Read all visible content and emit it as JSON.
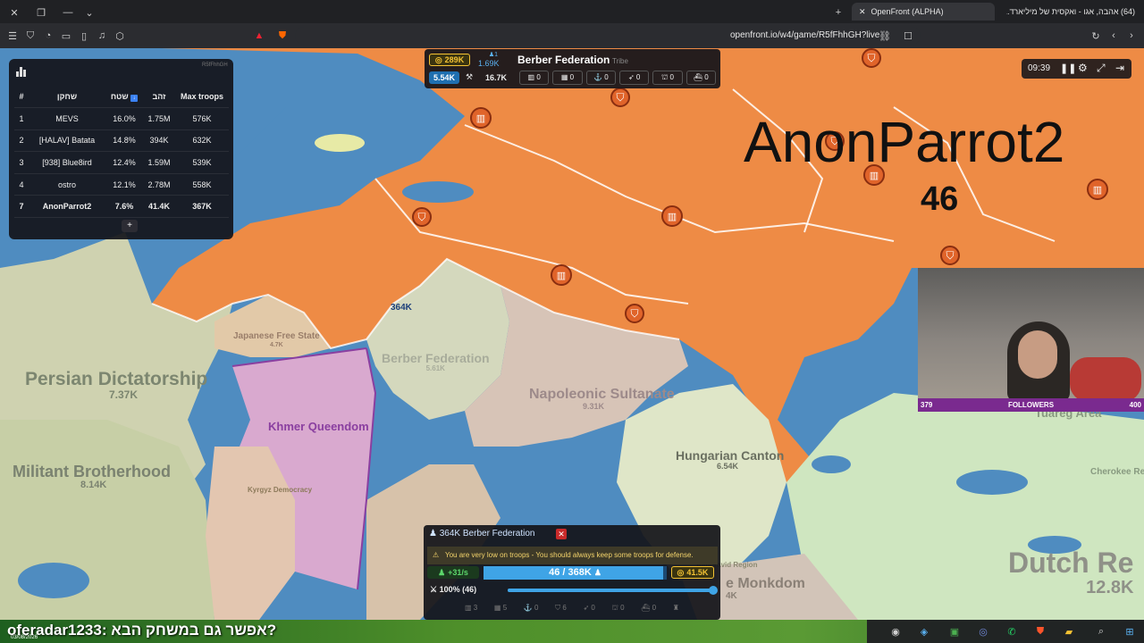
{
  "browser": {
    "tabs": [
      {
        "label": "OpenFront (ALPHA)"
      },
      {
        "label": "(64) אהבה, אגו - ואקסית של מיליארד..."
      }
    ],
    "url": "openfront.io/w4/game/R5fFhhGH?live"
  },
  "leaderboard": {
    "game_id": "R5fFhhGH",
    "headers": {
      "rank": "#",
      "player": "שחקן",
      "land": "שטח",
      "gold": "זהב",
      "troops": "Max troops"
    },
    "rows": [
      {
        "rank": "1",
        "player": "MEVS",
        "land": "16.0%",
        "gold": "1.75M",
        "troops": "576K"
      },
      {
        "rank": "2",
        "player": "[HALAV] Batata",
        "land": "14.8%",
        "gold": "394K",
        "troops": "632K"
      },
      {
        "rank": "3",
        "player": "[938] Blue8ird",
        "land": "12.4%",
        "gold": "1.59M",
        "troops": "539K"
      },
      {
        "rank": "4",
        "player": "ostro",
        "land": "12.1%",
        "gold": "2.78M",
        "troops": "558K"
      },
      {
        "rank": "7",
        "player": "AnonParrot2",
        "land": "7.6%",
        "gold": "41.4K",
        "troops": "367K"
      }
    ],
    "expand_label": "+"
  },
  "player_panel": {
    "gold": "289K",
    "troops_small": "1.69K",
    "name": "Berber Federation",
    "type": "Tribe",
    "troops": "5.54K",
    "workers": "16.7K",
    "stats": [
      "0",
      "0",
      "0",
      "0",
      "0",
      "0"
    ]
  },
  "time_panel": {
    "time": "09:39"
  },
  "map_labels": {
    "big_name": "AnonParrot2",
    "big_count": "46",
    "troop_marker": "364K",
    "regions": [
      {
        "name": "Persian Dictatorship",
        "value": "7.37K"
      },
      {
        "name": "Berber Federation",
        "value": "5.61K"
      },
      {
        "name": "Napoleonic Sultanate",
        "value": "9.31K"
      },
      {
        "name": "Khmer Queendom",
        "value": ""
      },
      {
        "name": "Militant Brotherhood",
        "value": "8.14K"
      },
      {
        "name": "Hungarian Canton",
        "value": "6.54K"
      },
      {
        "name": "Japanese Free State",
        "value": "4.7K"
      },
      {
        "name": "Kyrgyz Democracy",
        "value": ""
      },
      {
        "name": "Almoravid Region",
        "value": ""
      },
      {
        "name": "Tuareg Area",
        "value": ""
      },
      {
        "name": "Cherokee Rege",
        "value": ""
      },
      {
        "name": "Dutch Re",
        "value": "12.8K"
      },
      {
        "name": "e Monkdom",
        "value": "4K"
      }
    ]
  },
  "webcam": {
    "followers_label": "FOLLOWERS",
    "left_count": "379",
    "right_count": "400"
  },
  "control": {
    "target_troops": "364K",
    "target_name": "Berber Federation",
    "warning": "You are very low on troops - You should always keep some troops for defense.",
    "rate": "+31/s",
    "troops_text": "46 / 368K",
    "troops_ratio": 0.0001,
    "gold": "41.5K",
    "attack_ratio": "100% (46)",
    "slider_level": 1.0,
    "build_counts": [
      "3",
      "5",
      "0",
      "6",
      "0",
      "0",
      "0"
    ]
  },
  "stream": {
    "chat": "oferadar1233: אפשר גם במשחק הבא?",
    "date": "03/08/2026"
  },
  "colors": {
    "orange": "#ee8b45",
    "sea": "#4f8cc0",
    "gold": "#f3c233",
    "blue": "#3fa4e6"
  }
}
